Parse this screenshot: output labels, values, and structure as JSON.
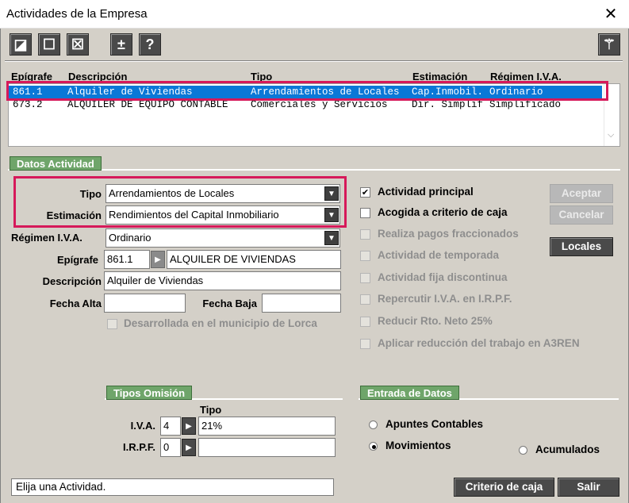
{
  "window": {
    "title": "Actividades de la Empresa",
    "close_glyph": "✕"
  },
  "toolbar": {
    "buttons": [
      {
        "glyph": "◪",
        "icon": "half-square-icon"
      },
      {
        "glyph": "☐",
        "icon": "square-icon"
      },
      {
        "glyph": "☒",
        "icon": "box-x-icon"
      },
      {
        "glyph": "±",
        "icon": "plus-minus-icon"
      },
      {
        "glyph": "?",
        "icon": "help-icon"
      }
    ],
    "wand_glyph": "⚚"
  },
  "list": {
    "columns": [
      "Epígrafe",
      "Descripción",
      "Tipo",
      "Estimación",
      "Régimen I.V.A."
    ],
    "rows": [
      [
        "861.1",
        "Alquiler de Viviendas",
        "Arrendamientos de Locales",
        "Cap.Inmobil.",
        "Ordinario"
      ],
      [
        "673.2",
        "ALQUILER DE EQUIPO CONTABLE",
        "Comerciales y Servicios",
        "Dir. Simplif",
        "Simplificado"
      ]
    ]
  },
  "datos": {
    "group_title": "Datos Actividad",
    "tipo_label": "Tipo",
    "tipo_value": "Arrendamientos de Locales",
    "estimacion_label": "Estimación",
    "estimacion_value": "Rendimientos del Capital Inmobiliario",
    "regimen_label": "Régimen I.V.A.",
    "regimen_value": "Ordinario",
    "epigrafe_label": "Epígrafe",
    "epigrafe_code": "861.1",
    "epigrafe_desc": "ALQUILER DE VIVIENDAS",
    "descripcion_label": "Descripción",
    "descripcion_value": "Alquiler de Viviendas",
    "fecha_alta_label": "Fecha Alta",
    "fecha_alta_value": "",
    "fecha_baja_label": "Fecha Baja",
    "fecha_baja_value": "",
    "lorca_label": "Desarrollada en el municipio de Lorca"
  },
  "checks": [
    {
      "label": "Actividad principal",
      "checked": true,
      "disabled": false
    },
    {
      "label": "Acogida a criterio de caja",
      "checked": false,
      "disabled": false
    },
    {
      "label": "Realiza pagos fraccionados",
      "checked": false,
      "disabled": true
    },
    {
      "label": "Actividad de temporada",
      "checked": false,
      "disabled": true
    },
    {
      "label": "Actividad fija discontinua",
      "checked": false,
      "disabled": true
    },
    {
      "label": "Repercutir I.V.A. en I.R.P.F.",
      "checked": false,
      "disabled": true
    },
    {
      "label": "Reducir Rto. Neto 25%",
      "checked": false,
      "disabled": true
    },
    {
      "label": "Aplicar reducción del trabajo en A3REN",
      "checked": false,
      "disabled": true
    }
  ],
  "buttons": {
    "aceptar": "Aceptar",
    "cancelar": "Cancelar",
    "locales": "Locales",
    "criterio": "Criterio de caja",
    "salir": "Salir"
  },
  "omision": {
    "title": "Tipos Omisión",
    "tipo_header": "Tipo",
    "iva_label": "I.V.A.",
    "iva_code": "4",
    "iva_tipo": "21%",
    "irpf_label": "I.R.P.F.",
    "irpf_code": "0",
    "irpf_tipo": ""
  },
  "entrada": {
    "title": "Entrada de Datos",
    "options": [
      "Apuntes Contables",
      "Movimientos",
      "Acumulados"
    ],
    "selected": "Movimientos"
  },
  "status": {
    "text": "Elija una Actividad."
  },
  "colors": {
    "selection": "#0a78d7",
    "highlight_border": "#d6195a",
    "group_tab": "#6fa56a",
    "dialog_bg": "#d4d0c8"
  }
}
